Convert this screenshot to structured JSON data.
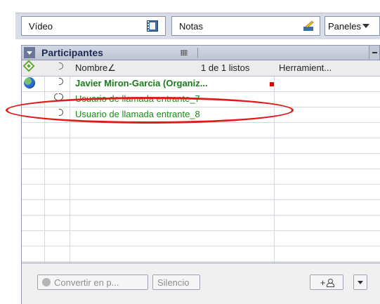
{
  "toolbar": {
    "video_label": "Vídeo",
    "notes_label": "Notas",
    "panels_label": "Paneles",
    "video_icon": "video-icon",
    "notes_icon": "notes-icon"
  },
  "panel": {
    "title": "Participantes",
    "columns": {
      "name": "Nombre∠",
      "count": "1 de 1 listos",
      "tools": "Herramient..."
    },
    "participants": [
      {
        "name": "Javier Miron-Garcia (Organiz...",
        "role": "organizer",
        "icon": "globe-icon",
        "status_icon": "phone-icon"
      },
      {
        "name": "Usuario de llamada entrante_7",
        "role": "guest",
        "status_icon": "phone-ringing-icon"
      },
      {
        "name": "Usuario de llamada entrante_8",
        "role": "guest",
        "status_icon": "phone-icon"
      }
    ]
  },
  "bottom": {
    "convert_label": "Convertir en p...",
    "mute_label": "Silencio",
    "add_label": "+"
  },
  "colors": {
    "organizer_name": "#1b7a1b",
    "guest_name": "#1b8a1b",
    "highlight_ellipse": "#e11a1a"
  }
}
